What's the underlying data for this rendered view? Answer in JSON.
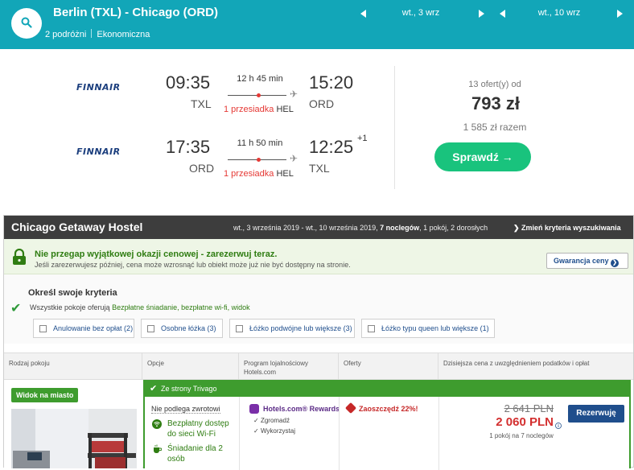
{
  "search": {
    "route": "Berlin (TXL) - Chicago (ORD)",
    "travellers": "2 podróżni",
    "cabin": "Ekonomiczna",
    "depart_date": "wt., 3 wrz",
    "return_date": "wt., 10 wrz"
  },
  "flight": {
    "outbound": {
      "airline": "FINNAIR",
      "dep_time": "09:35",
      "dep_airport": "TXL",
      "duration": "12 h 45 min",
      "stops": "1 przesiadka",
      "hub": "HEL",
      "arr_time": "15:20",
      "arr_airport": "ORD"
    },
    "inbound": {
      "airline": "FINNAIR",
      "dep_time": "17:35",
      "dep_airport": "ORD",
      "duration": "11 h 50 min",
      "stops": "1 przesiadka",
      "hub": "HEL",
      "arr_time": "12:25",
      "arr_day_offset": "+1",
      "arr_airport": "TXL"
    },
    "offers": "13 ofert(y) od",
    "price": "793 zł",
    "total": "1 585 zł razem",
    "check_label": "Sprawdź →"
  },
  "hotel": {
    "name": "Chicago Getaway Hostel",
    "dates_prefix": "wt., 3 września 2019 - wt., 10 września 2019,",
    "nights": "7 noclegów",
    "dates_suffix": ", 1 pokój, 2 dorosłych",
    "change_label": "Zmień kryteria wyszukiwania",
    "alert_title": "Nie przegap wyjątkowej okazji cenowej - zarezerwuj teraz.",
    "alert_sub": "Jeśli zarezerwujesz później, cena może wzrosnąć lub obiekt może już nie być dostępny na stronie.",
    "guarantee_label": "Gwarancja ceny",
    "criteria_title": "Określ swoje kryteria",
    "criteria_desc_prefix": "Wszystkie pokoje oferują",
    "criteria_desc_items": "Bezpłatne śniadanie, bezpłatne wi-fi, widok",
    "filters": [
      "Anulowanie bez opłat (2)",
      "Osobne łóżka (3)",
      "Łóżko podwójne lub większe (3)",
      "Łóżko typu queen lub większe (1)"
    ],
    "columns": {
      "room_type": "Rodzaj pokoju",
      "options": "Opcje",
      "loyalty": "Program lojalnościowy Hotels.com",
      "offers": "Oferty",
      "price": "Dzisiejsza cena z uwzględnieniem podatków i opłat"
    },
    "row": {
      "view_badge": "Widok na miasto",
      "source": "Ze strony Trivago",
      "refund": "Nie podlega zwrotowi",
      "wifi": "Bezpłatny dostęp do sieci Wi-Fi",
      "breakfast": "Śniadanie dla 2 osób",
      "loyalty_title": "Hotels.com® Rewards",
      "loyalty_collect": "Zgromadź",
      "loyalty_use": "Wykorzystaj",
      "deal": "Zaoszczędź 22%!",
      "old_price": "2 641 PLN",
      "new_price": "2 060 PLN",
      "price_note": "1 pokój na 7 noclegów",
      "reserve_label": "Rezerwuję"
    }
  },
  "colors": {
    "topbar": "#12a6b8",
    "cta_green": "#19c37d",
    "hotel_green": "#3e9c2e",
    "price_red": "#d32f2f",
    "link_blue": "#1f4e8c"
  }
}
